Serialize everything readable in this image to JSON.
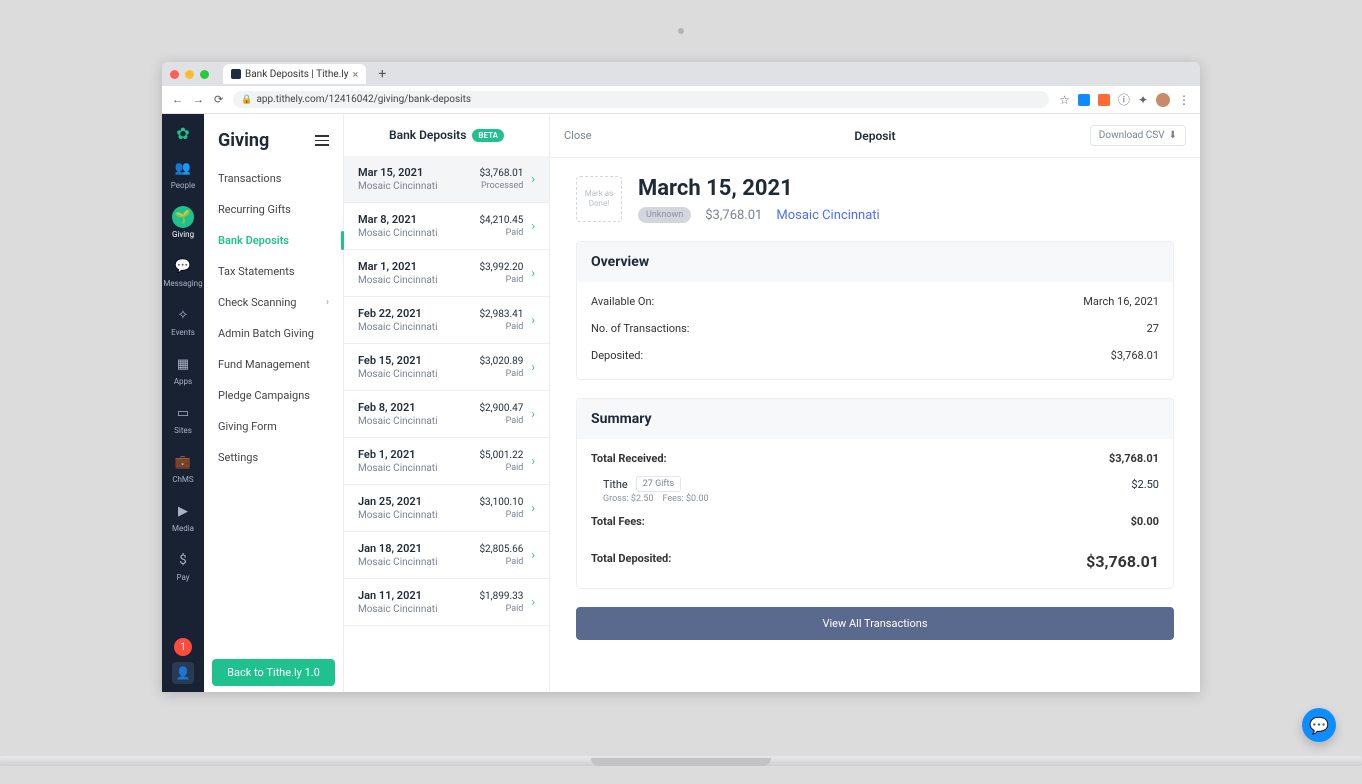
{
  "browser": {
    "tab_title": "Bank Deposits | Tithe.ly",
    "url": "app.tithely.com/12416042/giving/bank-deposits"
  },
  "rail": {
    "items": [
      {
        "label": "People",
        "icon": "👥"
      },
      {
        "label": "Giving",
        "icon": "🌱",
        "active": true
      },
      {
        "label": "Messaging",
        "icon": "💬"
      },
      {
        "label": "Events",
        "icon": "✧"
      },
      {
        "label": "Apps",
        "icon": "▦"
      },
      {
        "label": "Sites",
        "icon": "▭"
      },
      {
        "label": "ChMS",
        "icon": "💼"
      },
      {
        "label": "Media",
        "icon": "▶"
      },
      {
        "label": "Pay",
        "icon": "$"
      }
    ],
    "badge": "1"
  },
  "sidebar": {
    "title": "Giving",
    "items": [
      {
        "label": "Transactions"
      },
      {
        "label": "Recurring Gifts"
      },
      {
        "label": "Bank Deposits",
        "active": true
      },
      {
        "label": "Tax Statements"
      },
      {
        "label": "Check Scanning",
        "hasSub": true
      },
      {
        "label": "Admin Batch Giving"
      },
      {
        "label": "Fund Management"
      },
      {
        "label": "Pledge Campaigns"
      },
      {
        "label": "Giving Form"
      },
      {
        "label": "Settings"
      }
    ],
    "back_label": "Back to Tithe.ly 1.0"
  },
  "deposits": {
    "header": "Bank Deposits",
    "beta": "BETA",
    "items": [
      {
        "date": "Mar 15, 2021",
        "org": "Mosaic Cincinnati",
        "amount": "$3,768.01",
        "status": "Processed",
        "selected": true
      },
      {
        "date": "Mar 8, 2021",
        "org": "Mosaic Cincinnati",
        "amount": "$4,210.45",
        "status": "Paid"
      },
      {
        "date": "Mar 1, 2021",
        "org": "Mosaic Cincinnati",
        "amount": "$3,992.20",
        "status": "Paid"
      },
      {
        "date": "Feb 22, 2021",
        "org": "Mosaic Cincinnati",
        "amount": "$2,983.41",
        "status": "Paid"
      },
      {
        "date": "Feb 15, 2021",
        "org": "Mosaic Cincinnati",
        "amount": "$3,020.89",
        "status": "Paid"
      },
      {
        "date": "Feb 8, 2021",
        "org": "Mosaic Cincinnati",
        "amount": "$2,900.47",
        "status": "Paid"
      },
      {
        "date": "Feb 1, 2021",
        "org": "Mosaic Cincinnati",
        "amount": "$5,001.22",
        "status": "Paid"
      },
      {
        "date": "Jan 25, 2021",
        "org": "Mosaic Cincinnati",
        "amount": "$3,100.10",
        "status": "Paid"
      },
      {
        "date": "Jan 18, 2021",
        "org": "Mosaic Cincinnati",
        "amount": "$2,805.66",
        "status": "Paid"
      },
      {
        "date": "Jan 11, 2021",
        "org": "Mosaic Cincinnati",
        "amount": "$1,899.33",
        "status": "Paid"
      }
    ]
  },
  "detail": {
    "close": "Close",
    "title": "Deposit",
    "download": "Download CSV",
    "mark_done": "Mark as Done!",
    "big_date": "March 15, 2021",
    "status_pill": "Unknown",
    "amount": "$3,768.01",
    "org": "Mosaic Cincinnati",
    "overview": {
      "header": "Overview",
      "available_label": "Available On:",
      "available_value": "March 16, 2021",
      "transactions_label": "No. of Transactions:",
      "transactions_value": "27",
      "deposited_label": "Deposited:",
      "deposited_value": "$3,768.01"
    },
    "summary": {
      "header": "Summary",
      "received_label": "Total Received:",
      "received_value": "$3,768.01",
      "tithe_label": "Tithe",
      "tithe_gifts": "27 Gifts",
      "tithe_amount": "$2.50",
      "gross_label": "Gross: $2.50",
      "fees_label": "Fees: $0.00",
      "total_fees_label": "Total Fees:",
      "total_fees_value": "$0.00",
      "total_deposited_label": "Total Deposited:",
      "total_deposited_value": "$3,768.01"
    },
    "view_all": "View All Transactions"
  }
}
